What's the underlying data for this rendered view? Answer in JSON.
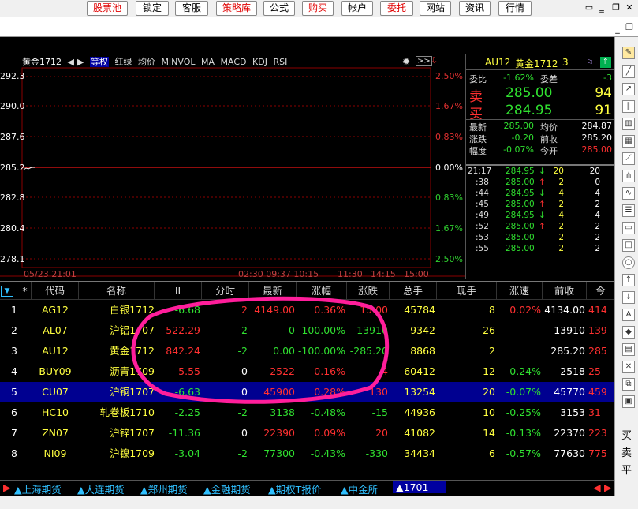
{
  "top_buttons": [
    "股票池",
    "锁定",
    "客服",
    "策略库",
    "公式",
    "购买",
    "帐户",
    "委托",
    "网站",
    "资讯",
    "行情"
  ],
  "chart": {
    "tabs": [
      "黄金1712",
      "等权",
      "红绿",
      "均价",
      "MINVOL",
      "MA",
      "MACD",
      "KDJ",
      "RSI"
    ],
    "left_ticks": [
      "292.3",
      "290.0",
      "287.6",
      "285.2",
      "282.8",
      "280.4",
      "278.1"
    ],
    "right_ticks": [
      "2.50%",
      "1.67%",
      "0.83%",
      "0.00%",
      "0.83%",
      "1.67%",
      "2.50%"
    ],
    "time_ticks": [
      "05/23 21:01",
      "02:30 09:37 10:15",
      "11:30",
      "14:15",
      "15:00"
    ]
  },
  "quote": {
    "code": "AU12",
    "name": "黄金1712",
    "num": "3",
    "weibi_label": "委比",
    "weibi": "-1.62%",
    "weicha_label": "委差",
    "weicha": "-3",
    "sell_label": "卖",
    "sell_price": "285.00",
    "sell_vol": "94",
    "buy_label": "买",
    "buy_price": "284.95",
    "buy_vol": "91",
    "stats": [
      {
        "l1": "最新",
        "v1": "285.00",
        "l2": "均价",
        "v2": "284.87"
      },
      {
        "l1": "涨跌",
        "v1": "-0.20",
        "l2": "前收",
        "v2": "285.20"
      },
      {
        "l1": "幅度",
        "v1": "-0.07%",
        "l2": "今开",
        "v2": "285.00"
      }
    ],
    "ticks": [
      {
        "t": "21:17",
        "p": "284.95",
        "d": "↓",
        "v": "20",
        "x": "20"
      },
      {
        "t": ":38",
        "p": "285.00",
        "d": "↑",
        "v": "2",
        "x": "0"
      },
      {
        "t": ":44",
        "p": "284.95",
        "d": "↓",
        "v": "4",
        "x": "4"
      },
      {
        "t": ":45",
        "p": "285.00",
        "d": "↑",
        "v": "2",
        "x": "2"
      },
      {
        "t": ":49",
        "p": "284.95",
        "d": "↓",
        "v": "4",
        "x": "4"
      },
      {
        "t": ":52",
        "p": "285.00",
        "d": "↑",
        "v": "2",
        "x": "2"
      },
      {
        "t": ":53",
        "p": "285.00",
        "d": "",
        "v": "2",
        "x": "2"
      },
      {
        "t": ":55",
        "p": "285.00",
        "d": "",
        "v": "2",
        "x": "2"
      }
    ]
  },
  "table": {
    "headers": [
      "*",
      "代码",
      "名称",
      "II",
      "分时",
      "最新",
      "涨幅",
      "涨跌",
      "总手",
      "现手",
      "涨速",
      "前收",
      "今"
    ],
    "rows": [
      {
        "n": "1",
        "code": "AG12",
        "name": "白银1712",
        "ii": "-6.68",
        "fs": "2",
        "last": "4149.00",
        "chg": "0.36%",
        "diff": "15.00",
        "vol": "45784",
        "cur": "8",
        "spd": "0.02%",
        "prev": "4134.00",
        "x": "414"
      },
      {
        "n": "2",
        "code": "AL07",
        "name": "沪铝1707",
        "ii": "522.29",
        "fs": "-2",
        "last": "0",
        "chg": "-100.00%",
        "diff": "-13910",
        "vol": "9342",
        "cur": "26",
        "spd": "",
        "prev": "13910",
        "x": "139"
      },
      {
        "n": "3",
        "code": "AU12",
        "name": "黄金1712",
        "ii": "842.24",
        "fs": "-2",
        "last": "0.00",
        "chg": "-100.00%",
        "diff": "-285.20",
        "vol": "8868",
        "cur": "2",
        "spd": "",
        "prev": "285.20",
        "x": "285"
      },
      {
        "n": "4",
        "code": "BUY09",
        "name": "沥青1709",
        "ii": "5.55",
        "fs": "0",
        "last": "2522",
        "chg": "0.16%",
        "diff": "4",
        "vol": "60412",
        "cur": "12",
        "spd": "-0.24%",
        "prev": "2518",
        "x": "25"
      },
      {
        "n": "5",
        "code": "CU07",
        "name": "沪铜1707",
        "ii": "-6.63",
        "fs": "0",
        "last": "45900",
        "chg": "0.28%",
        "diff": "130",
        "vol": "13254",
        "cur": "20",
        "spd": "-0.07%",
        "prev": "45770",
        "x": "459"
      },
      {
        "n": "6",
        "code": "HC10",
        "name": "轧卷板1710",
        "ii": "-2.25",
        "fs": "-2",
        "last": "3138",
        "chg": "-0.48%",
        "diff": "-15",
        "vol": "44936",
        "cur": "10",
        "spd": "-0.25%",
        "prev": "3153",
        "x": "31"
      },
      {
        "n": "7",
        "code": "ZN07",
        "name": "沪锌1707",
        "ii": "-11.36",
        "fs": "0",
        "last": "22390",
        "chg": "0.09%",
        "diff": "20",
        "vol": "41082",
        "cur": "14",
        "spd": "-0.13%",
        "prev": "22370",
        "x": "223"
      },
      {
        "n": "8",
        "code": "NI09",
        "name": "沪镍1709",
        "ii": "-3.04",
        "fs": "-2",
        "last": "77300",
        "chg": "-0.43%",
        "diff": "-330",
        "vol": "34434",
        "cur": "6",
        "spd": "-0.57%",
        "prev": "77630",
        "x": "775"
      }
    ]
  },
  "bottom_tabs": [
    "上海期货",
    "大连期货",
    "郑州期货",
    "金融期货",
    "期权T报价",
    "中金所",
    "1701"
  ],
  "sidebar_text": [
    "买",
    "卖",
    "平"
  ],
  "colors": {
    "up": "#ff3030",
    "down": "#30e030",
    "highlight": "#ff1e9b",
    "selected_row": "#000090"
  }
}
